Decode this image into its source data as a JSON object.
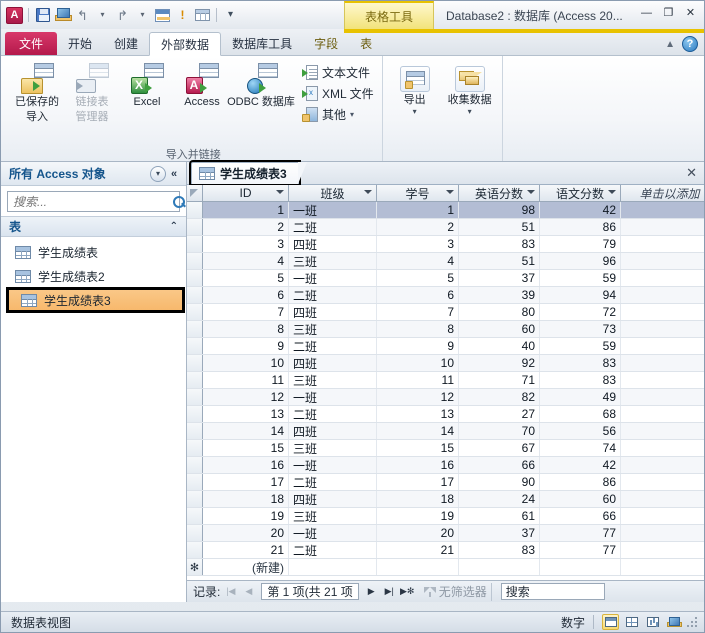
{
  "window": {
    "app_logo": "A",
    "title": "Database2 : 数据库 (Access 20...",
    "contextual_tab_group": "表格工具",
    "minimize": "—",
    "maximize": "❐",
    "close": "✕"
  },
  "quick_access": [
    {
      "name": "save-icon",
      "tooltip": "保存"
    },
    {
      "name": "design-view-icon",
      "tooltip": "视图"
    },
    {
      "name": "undo-icon",
      "glyph": "↰"
    },
    {
      "name": "undo-caret",
      "glyph": "▾"
    },
    {
      "name": "redo-icon",
      "glyph": "↱"
    },
    {
      "name": "redo-caret",
      "glyph": "▾"
    },
    {
      "name": "form-icon",
      "tooltip": "窗体"
    },
    {
      "name": "exclamation-icon",
      "glyph": "!"
    },
    {
      "name": "table-icon",
      "tooltip": "表"
    },
    {
      "name": "customize-qat-caret",
      "glyph": "▾"
    }
  ],
  "ribbon": {
    "tabs": [
      {
        "label": "文件",
        "type": "file"
      },
      {
        "label": "开始",
        "type": "normal"
      },
      {
        "label": "创建",
        "type": "normal"
      },
      {
        "label": "外部数据",
        "type": "active"
      },
      {
        "label": "数据库工具",
        "type": "normal"
      },
      {
        "label": "字段",
        "type": "contextual"
      },
      {
        "label": "表",
        "type": "contextual"
      }
    ],
    "collapse_label": "▲",
    "help_label": "?",
    "groups": [
      {
        "label": "导入并链接",
        "big_buttons": [
          {
            "label_line1": "已保存的",
            "label_line2": "导入",
            "icon": "saved-imports-icon",
            "disabled": false
          },
          {
            "label_line1": "链接表",
            "label_line2": "管理器",
            "icon": "linked-table-manager-icon",
            "disabled": true
          },
          {
            "label_line1": "Excel",
            "label_line2": "",
            "icon": "excel-icon",
            "disabled": false
          },
          {
            "label_line1": "Access",
            "label_line2": "",
            "icon": "access-icon",
            "disabled": false
          },
          {
            "label_line1": "ODBC 数据库",
            "label_line2": "",
            "icon": "odbc-database-icon",
            "disabled": false
          }
        ],
        "small_buttons": [
          {
            "label": "文本文件",
            "icon": "text-file-icon",
            "caret": false
          },
          {
            "label": "XML 文件",
            "icon": "xml-file-icon",
            "caret": false
          },
          {
            "label": "其他",
            "icon": "other-source-icon",
            "caret": true
          }
        ]
      },
      {
        "label": "",
        "big_buttons": [
          {
            "label_line1": "导出",
            "label_line2": "",
            "icon": "export-icon",
            "caret": "▾"
          },
          {
            "label_line1": "收集数据",
            "label_line2": "",
            "icon": "collect-data-icon",
            "caret": "▾"
          }
        ],
        "small_buttons": []
      }
    ]
  },
  "nav_pane": {
    "header": "所有 Access 对象",
    "dropdown_glyph": "▾",
    "collapse_glyph": "«",
    "search_placeholder": "搜索...",
    "search_value": "",
    "search_icon": "search-icon",
    "group_label": "表",
    "group_chevron": "⌃",
    "items": [
      {
        "label": "学生成绩表",
        "selected": false
      },
      {
        "label": "学生成绩表2",
        "selected": false
      },
      {
        "label": "学生成绩表3",
        "selected": true
      }
    ]
  },
  "document": {
    "tab_label": "学生成绩表3",
    "tab_icon": "table-icon",
    "close_glyph": "✕"
  },
  "datasheet": {
    "columns": [
      {
        "label": "ID",
        "width_class": "w-id",
        "align": "num"
      },
      {
        "label": "班级",
        "width_class": "w-cls",
        "align": "text"
      },
      {
        "label": "学号",
        "width_class": "w-num",
        "align": "num"
      },
      {
        "label": "英语分数",
        "width_class": "w-eng",
        "align": "num"
      },
      {
        "label": "语文分数",
        "width_class": "w-chn",
        "align": "num"
      },
      {
        "label": "单击以添加",
        "width_class": "w-add",
        "align": "text"
      }
    ],
    "rows": [
      {
        "id": "1",
        "class": "一班",
        "sid": "1",
        "english": "98",
        "chinese": "42",
        "selected": true
      },
      {
        "id": "2",
        "class": "二班",
        "sid": "2",
        "english": "51",
        "chinese": "86",
        "selected": false
      },
      {
        "id": "3",
        "class": "四班",
        "sid": "3",
        "english": "83",
        "chinese": "79",
        "selected": false
      },
      {
        "id": "4",
        "class": "三班",
        "sid": "4",
        "english": "51",
        "chinese": "96",
        "selected": false
      },
      {
        "id": "5",
        "class": "一班",
        "sid": "5",
        "english": "37",
        "chinese": "59",
        "selected": false
      },
      {
        "id": "6",
        "class": "二班",
        "sid": "6",
        "english": "39",
        "chinese": "94",
        "selected": false
      },
      {
        "id": "7",
        "class": "四班",
        "sid": "7",
        "english": "80",
        "chinese": "72",
        "selected": false
      },
      {
        "id": "8",
        "class": "三班",
        "sid": "8",
        "english": "60",
        "chinese": "73",
        "selected": false
      },
      {
        "id": "9",
        "class": "二班",
        "sid": "9",
        "english": "40",
        "chinese": "59",
        "selected": false
      },
      {
        "id": "10",
        "class": "四班",
        "sid": "10",
        "english": "92",
        "chinese": "83",
        "selected": false
      },
      {
        "id": "11",
        "class": "三班",
        "sid": "11",
        "english": "71",
        "chinese": "83",
        "selected": false
      },
      {
        "id": "12",
        "class": "一班",
        "sid": "12",
        "english": "82",
        "chinese": "49",
        "selected": false
      },
      {
        "id": "13",
        "class": "二班",
        "sid": "13",
        "english": "27",
        "chinese": "68",
        "selected": false
      },
      {
        "id": "14",
        "class": "四班",
        "sid": "14",
        "english": "70",
        "chinese": "56",
        "selected": false
      },
      {
        "id": "15",
        "class": "三班",
        "sid": "15",
        "english": "67",
        "chinese": "74",
        "selected": false
      },
      {
        "id": "16",
        "class": "一班",
        "sid": "16",
        "english": "66",
        "chinese": "42",
        "selected": false
      },
      {
        "id": "17",
        "class": "二班",
        "sid": "17",
        "english": "90",
        "chinese": "86",
        "selected": false
      },
      {
        "id": "18",
        "class": "四班",
        "sid": "18",
        "english": "24",
        "chinese": "60",
        "selected": false
      },
      {
        "id": "19",
        "class": "三班",
        "sid": "19",
        "english": "61",
        "chinese": "66",
        "selected": false
      },
      {
        "id": "20",
        "class": "一班",
        "sid": "20",
        "english": "37",
        "chinese": "77",
        "selected": false
      },
      {
        "id": "21",
        "class": "二班",
        "sid": "21",
        "english": "83",
        "chinese": "77",
        "selected": false
      }
    ],
    "new_row": {
      "marker": "✻",
      "label": "(新建)"
    }
  },
  "record_nav": {
    "label": "记录:",
    "first_glyph": "|◀",
    "prev_glyph": "◀",
    "counter_text": "第 1 项(共 21 项",
    "next_glyph": "▶",
    "last_glyph": "▶|",
    "new_glyph": "▶✻",
    "filter_label": "无筛选器",
    "filter_icon": "filter-icon",
    "search_value": "搜索"
  },
  "status_bar": {
    "view_label": "数据表视图",
    "field_type": "数字",
    "view_buttons": [
      {
        "name": "datasheet-view-button",
        "active": true
      },
      {
        "name": "pivottable-view-button",
        "active": false
      },
      {
        "name": "pivotchart-view-button",
        "active": false
      },
      {
        "name": "design-view-button",
        "active": false
      }
    ]
  },
  "colors": {
    "accent_red": "#b4194b",
    "contextual_yellow": "#e8c200",
    "selection_orange": "#f7b76a",
    "row_selection": "#b3bdd4",
    "nav_header_blue": "#15558c"
  }
}
